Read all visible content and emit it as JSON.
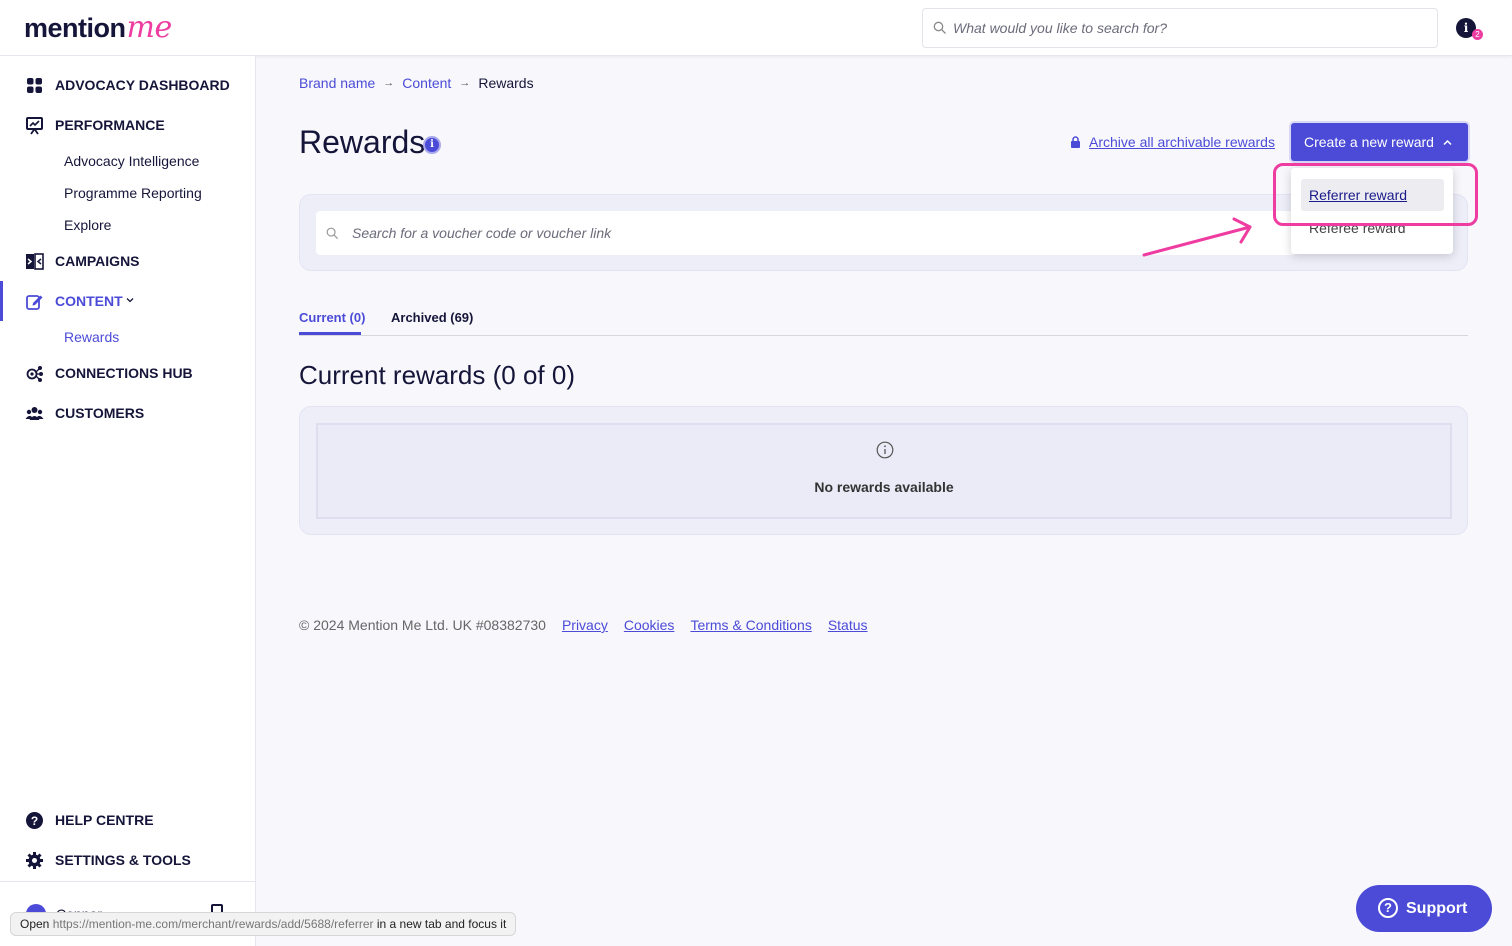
{
  "header": {
    "logo_text": "mention",
    "logo_script": "me",
    "search_placeholder": "What would you like to search for?",
    "info_icon": "i",
    "notification_count": "2"
  },
  "sidebar": {
    "items": [
      {
        "label": "ADVOCACY DASHBOARD",
        "icon": "grid-icon"
      },
      {
        "label": "PERFORMANCE",
        "icon": "chart-board-icon"
      },
      {
        "label": "CAMPAIGNS",
        "icon": "campaigns-icon"
      },
      {
        "label": "CONTENT",
        "icon": "edit-icon"
      },
      {
        "label": "CONNECTIONS HUB",
        "icon": "connections-icon"
      },
      {
        "label": "CUSTOMERS",
        "icon": "people-icon"
      },
      {
        "label": "HELP CENTRE",
        "icon": "help-icon"
      },
      {
        "label": "SETTINGS & TOOLS",
        "icon": "gear-icon"
      }
    ],
    "performance_sub": [
      "Advocacy Intelligence",
      "Programme Reporting",
      "Explore"
    ],
    "content_sub": [
      "Rewards"
    ],
    "user_name": "Connor"
  },
  "breadcrumb": {
    "items": [
      "Brand name",
      "Content",
      "Rewards"
    ],
    "separator": "→"
  },
  "page": {
    "title": "Rewards",
    "title_info": "i",
    "archive_link": "Archive all archivable rewards",
    "create_button": "Create a new reward",
    "voucher_search_placeholder": "Search for a voucher code or voucher link"
  },
  "dropdown": {
    "items": [
      "Referrer reward",
      "Referee reward"
    ]
  },
  "tabs": {
    "current": "Current (0)",
    "archived": "Archived (69)"
  },
  "section": {
    "title": "Current rewards (0 of 0)",
    "empty_message": "No rewards available"
  },
  "footer": {
    "copyright": "© 2024 Mention Me Ltd. UK #08382730",
    "links": [
      "Privacy",
      "Cookies",
      "Terms & Conditions",
      "Status"
    ]
  },
  "support": {
    "label": "Support",
    "icon_glyph": "?"
  },
  "status_bar": {
    "prefix": "Open",
    "url": "https://mention-me.com/merchant/rewards/add/5688/referrer",
    "suffix": "in a new tab and focus it"
  },
  "colors": {
    "accent": "#4b4bd8",
    "brand_pink": "#ee3ca1",
    "navy": "#15153a",
    "highlight": "#ee3ca1"
  }
}
